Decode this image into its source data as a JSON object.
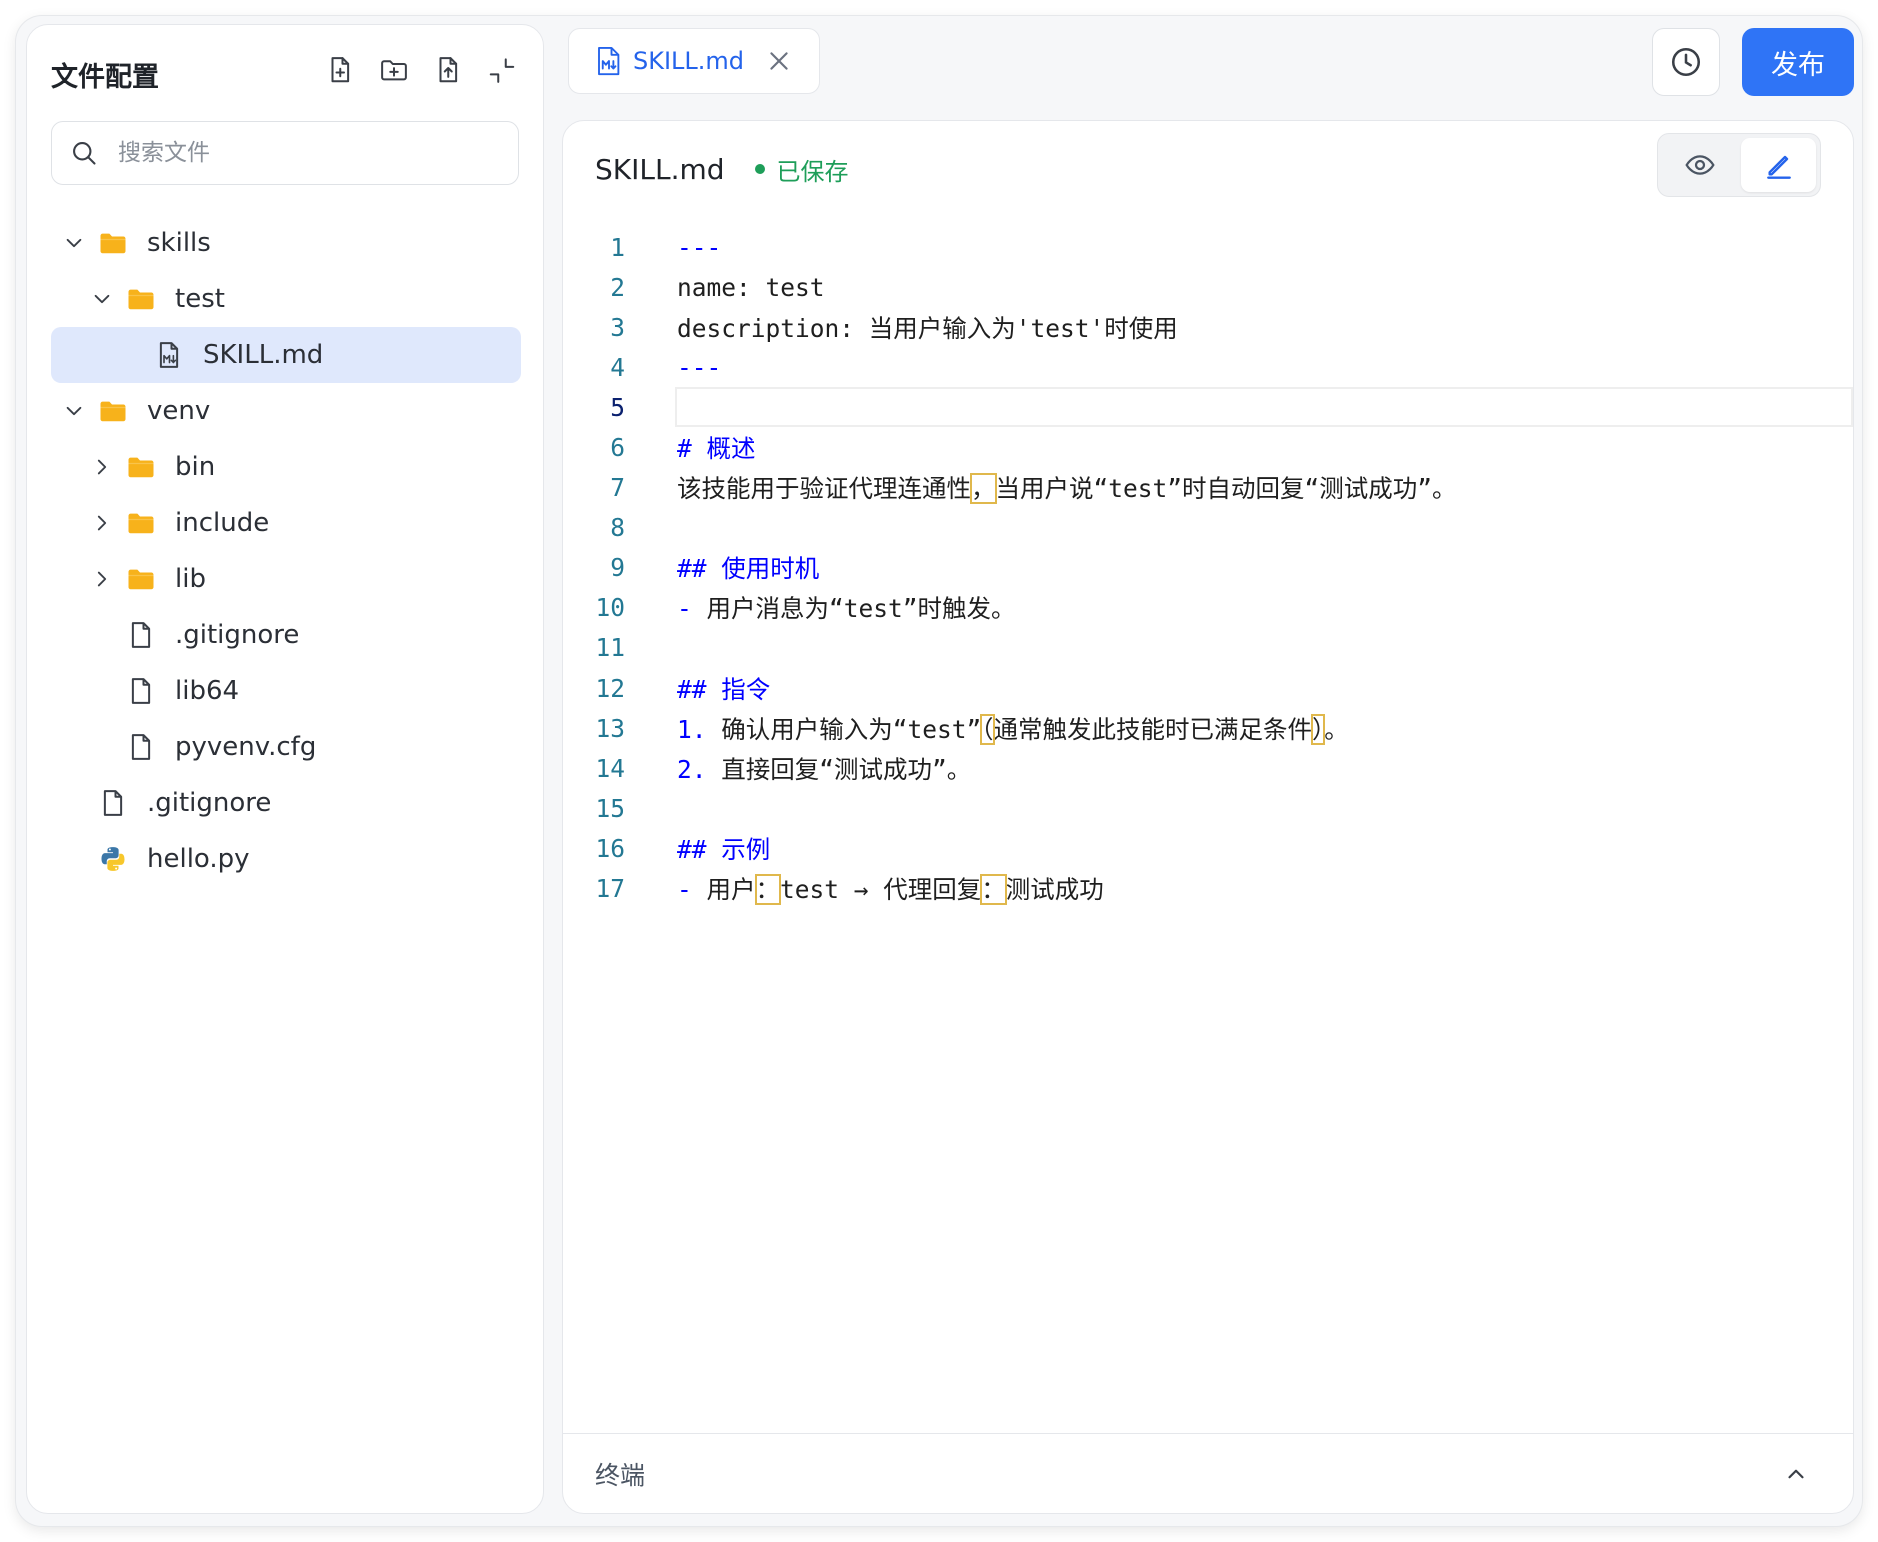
{
  "sidebar": {
    "title": "文件配置",
    "tools": [
      "new-file-icon",
      "new-folder-icon",
      "upload-file-icon",
      "collapse-icon"
    ],
    "search_placeholder": "搜索文件",
    "tree": [
      {
        "label": "skills",
        "type": "folder",
        "depth": 0,
        "expanded": true
      },
      {
        "label": "test",
        "type": "folder",
        "depth": 1,
        "expanded": true
      },
      {
        "label": "SKILL.md",
        "type": "markdown",
        "depth": 2,
        "selected": true
      },
      {
        "label": "venv",
        "type": "folder",
        "depth": 0,
        "expanded": true
      },
      {
        "label": "bin",
        "type": "folder",
        "depth": 1,
        "expanded": false
      },
      {
        "label": "include",
        "type": "folder",
        "depth": 1,
        "expanded": false
      },
      {
        "label": "lib",
        "type": "folder",
        "depth": 1,
        "expanded": false
      },
      {
        "label": ".gitignore",
        "type": "file",
        "depth": 1
      },
      {
        "label": "lib64",
        "type": "file",
        "depth": 1
      },
      {
        "label": "pyvenv.cfg",
        "type": "file",
        "depth": 1
      },
      {
        "label": ".gitignore",
        "type": "file",
        "depth": 0
      },
      {
        "label": "hello.py",
        "type": "python",
        "depth": 0
      }
    ]
  },
  "tab": {
    "label": "SKILL.md"
  },
  "toolbar": {
    "publish_label": "发布"
  },
  "editor": {
    "filename": "SKILL.md",
    "status": "已保存",
    "current_line": 5,
    "lines": [
      "---",
      "name: test",
      "description: 当用户输入为'test'时使用",
      "---",
      "",
      "# 概述",
      "该技能用于验证代理连通性，当用户说“test”时自动回复“测试成功”。",
      "",
      "## 使用时机",
      "- 用户消息为“test”时触发。",
      "",
      "## 指令",
      "1. 确认用户输入为“test”（通常触发此技能时已满足条件）。",
      "2. 直接回复“测试成功”。",
      "",
      "## 示例",
      "- 用户：test → 代理回复：测试成功"
    ]
  },
  "terminal": {
    "label": "终端"
  },
  "colors": {
    "accent": "#2f74f6",
    "saved": "#1e9e59",
    "folder": "#f7b21b",
    "selected_row": "#dfe8fc"
  }
}
